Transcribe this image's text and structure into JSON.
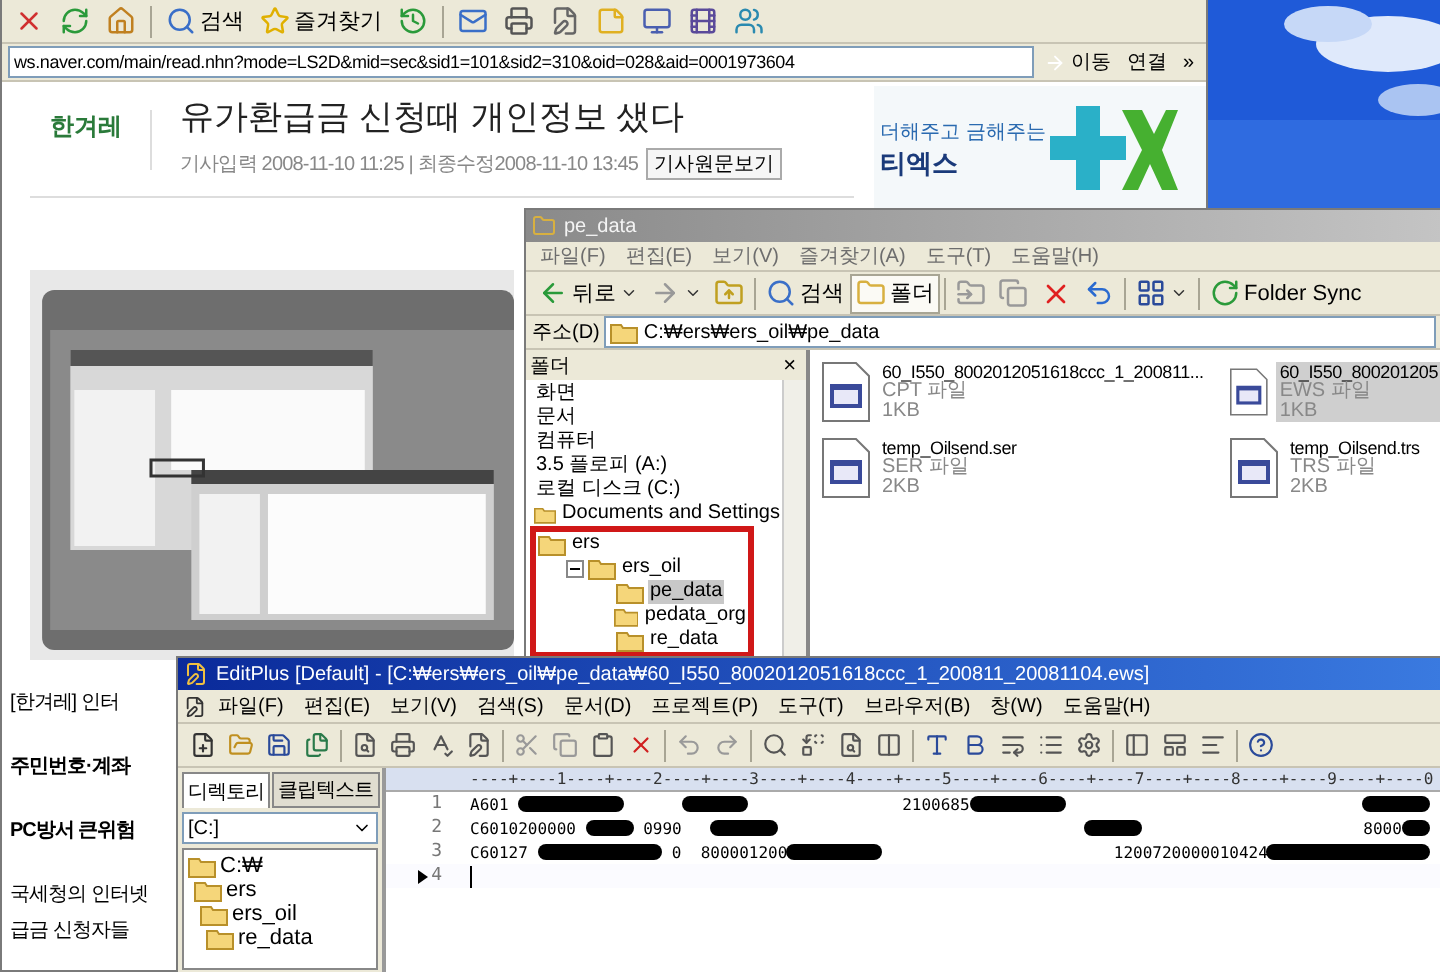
{
  "browser": {
    "toolbar": {
      "search": "검색",
      "favorites": "즐겨찾기"
    },
    "address": "ws.naver.com/main/read.nhn?mode=LS2D&mid=sec&sid1=101&sid2=310&oid=028&aid=0001973604",
    "go": "이동",
    "links": "연결",
    "chevron": "»"
  },
  "article": {
    "logo": "한겨레",
    "headline": "유가환급금 신청때 개인정보 샜다",
    "meta": "기사입력 2008-11-10 11:25 | 최종수정2008-11-10 13:45",
    "original_button": "기사원문보기",
    "paragraphs": [
      {
        "text": "[한겨레] 인터",
        "bold": false
      },
      {
        "text": "주민번호·계좌",
        "bold": true
      },
      {
        "text": "PC방서 큰위험",
        "bold": true
      },
      {
        "text": "국세청의 인터넷",
        "bold": false
      },
      {
        "text": "급금 신청자들",
        "bold": false
      }
    ]
  },
  "ad": {
    "tagline": "더해주고 금해주는",
    "brand": "티엑스"
  },
  "explorer": {
    "title": "pe_data",
    "menu": [
      "파일(F)",
      "편집(E)",
      "보기(V)",
      "즐겨찾기(A)",
      "도구(T)",
      "도움말(H)"
    ],
    "toolbar": {
      "back": "뒤로",
      "search": "검색",
      "folders": {
        "label": "폴더",
        "pressed": true
      },
      "sync": "Folder Sync"
    },
    "address_label": "주소(D)",
    "address": "C:₩ers₩ers_oil₩pe_data",
    "folder_pane": {
      "title": "폴더",
      "close": "×",
      "tree": [
        {
          "label": "화면",
          "kind": "plain",
          "selected": false
        },
        {
          "label": "문서",
          "kind": "plain",
          "selected": false
        },
        {
          "label": "컴퓨터",
          "kind": "plain",
          "selected": false
        },
        {
          "label": "3.5 플로피 (A:)",
          "kind": "plain",
          "selected": false
        },
        {
          "label": "로컬 디스크 (C:)",
          "kind": "plain",
          "selected": false
        },
        {
          "label": "Documents and Settings",
          "kind": "folder",
          "selected": false
        },
        {
          "label": "ers",
          "kind": "folder",
          "selected": false,
          "highlighted": true,
          "children": [
            {
              "label": "ers_oil",
              "kind": "folder",
              "selected": false,
              "expanded": true,
              "children": [
                {
                  "label": "pe_data",
                  "kind": "folder",
                  "selected": true
                },
                {
                  "label": "pedata_org",
                  "kind": "folder",
                  "selected": false
                },
                {
                  "label": "re_data",
                  "kind": "folder",
                  "selected": false
                }
              ]
            }
          ]
        }
      ]
    },
    "files": [
      {
        "name": "60_I550_8002012051618ccc_1_200811...",
        "type": "CPT 파일",
        "size": "1KB",
        "selected": false
      },
      {
        "name": "60_I550_800201205",
        "type": "EWS 파일",
        "size": "1KB",
        "selected": true
      },
      {
        "name": "temp_Oilsend.ser",
        "type": "SER 파일",
        "size": "2KB",
        "selected": false
      },
      {
        "name": "temp_Oilsend.trs",
        "type": "TRS 파일",
        "size": "2KB",
        "selected": false
      }
    ]
  },
  "editplus": {
    "title": "EditPlus [Default] - [C:₩ers₩ers_oil₩pe_data₩60_I550_8002012051618ccc_1_200811_20081104.ews]",
    "menu": [
      "파일(F)",
      "편집(E)",
      "보기(V)",
      "검색(S)",
      "문서(D)",
      "프로젝트(P)",
      "도구(T)",
      "브라우저(B)",
      "창(W)",
      "도움말(H)"
    ],
    "side_tabs": [
      {
        "label": "디렉토리",
        "selected": true
      },
      {
        "label": "클립텍스트",
        "selected": false
      }
    ],
    "drive": "[C:]",
    "tree": [
      {
        "label": "C:₩",
        "children": [
          {
            "label": "ers",
            "children": [
              {
                "label": "ers_oil",
                "children": [
                  {
                    "label": "re_data"
                  }
                ]
              }
            ]
          }
        ]
      }
    ],
    "ruler": "----+----1----+----2----+----3----+----4----+----5----+----6----+----7----+----8----+----9----+----0",
    "lines": [
      {
        "number": "1",
        "text": "A601                                         2100685",
        "current": false
      },
      {
        "number": "2",
        "text": "C6010200000       0990                                                                       8000",
        "current": false
      },
      {
        "number": "3",
        "text": "C60127               0  800001200                                  1200720000010424",
        "current": false
      },
      {
        "number": "4",
        "current": true
      }
    ]
  }
}
